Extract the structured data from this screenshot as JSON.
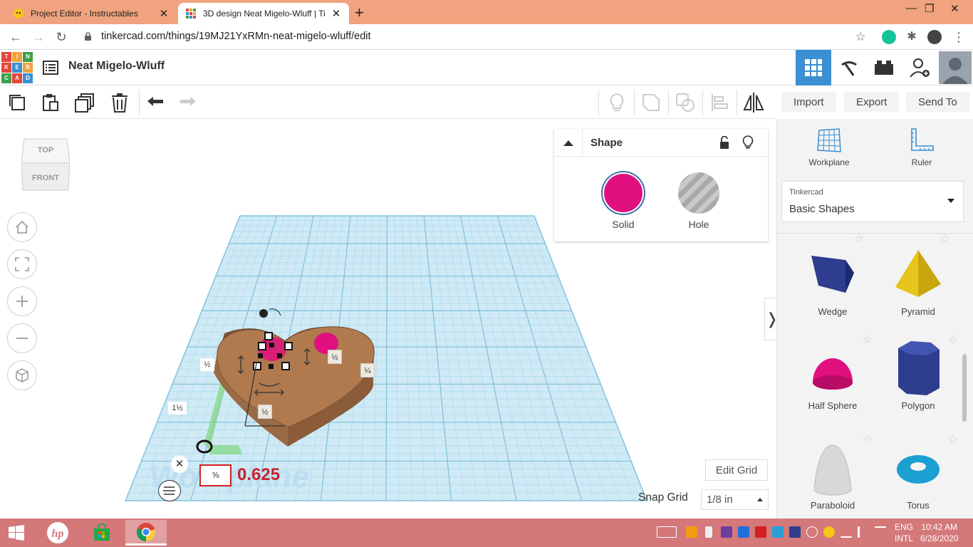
{
  "browser": {
    "tabs": [
      {
        "title": "Project Editor - Instructables",
        "close": "✕"
      },
      {
        "title": "3D design Neat Migelo-Wluff | Ti",
        "close": "✕"
      }
    ],
    "new_tab": "+",
    "window_controls": {
      "minimize": "—",
      "restore": "❐",
      "close": "✕"
    },
    "url": "tinkercad.com/things/19MJ21YxRMn-neat-migelo-wluff/edit"
  },
  "app": {
    "logo_letters": [
      "T",
      "I",
      "N",
      "K",
      "E",
      "R",
      "C",
      "A",
      "D"
    ],
    "logo_colors": [
      "#e2473a",
      "#f1a33a",
      "#3fa049",
      "#e2473a",
      "#3b8fd2",
      "#f1a33a",
      "#3fa049",
      "#e2473a",
      "#3b8fd2"
    ],
    "design_title": "Neat Migelo-Wluff",
    "accent_color": "#3b8fd2"
  },
  "toolbar": {
    "import_label": "Import",
    "export_label": "Export",
    "send_to_label": "Send To"
  },
  "viewcube": {
    "top_label": "TOP",
    "front_label": "FRONT"
  },
  "shape_panel": {
    "title": "Shape",
    "solid_label": "Solid",
    "hole_label": "Hole",
    "solid_color": "#e0107e"
  },
  "library": {
    "workplane_label": "Workplane",
    "ruler_label": "Ruler",
    "source_label": "Tinkercad",
    "category": "Basic Shapes",
    "shapes": [
      {
        "name": "Wedge",
        "color": "#2e3d8e"
      },
      {
        "name": "Pyramid",
        "color": "#e8c51a"
      },
      {
        "name": "Half Sphere",
        "color": "#e0107e"
      },
      {
        "name": "Polygon",
        "color": "#2e3d8e"
      },
      {
        "name": "Paraboloid",
        "color": "#d8d8d8"
      },
      {
        "name": "Torus",
        "color": "#1aa0d1"
      }
    ]
  },
  "workplane": {
    "watermark": "Workplane",
    "dim_labels": [
      "½",
      "1½",
      "½",
      "¼",
      "½"
    ],
    "edit_value_label": "⅝",
    "edit_value": "0.625",
    "heart_color": "#b07a4e"
  },
  "grid_controls": {
    "edit_grid_label": "Edit Grid",
    "snap_grid_label": "Snap Grid",
    "snap_grid_value": "1/8 in"
  },
  "taskbar": {
    "language_line1": "ENG",
    "language_line2": "INTL",
    "time": "10:42 AM",
    "date": "6/28/2020"
  }
}
